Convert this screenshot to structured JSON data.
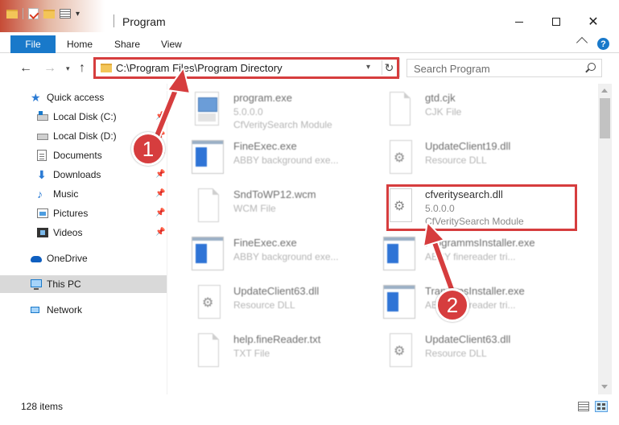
{
  "window": {
    "title": "Program",
    "controls": {
      "minimize": "minimize",
      "maximize": "maximize",
      "close": "✕"
    }
  },
  "ribbon": {
    "tabs": [
      "File",
      "Home",
      "Share",
      "View"
    ],
    "help": "?"
  },
  "address": {
    "path": "C:\\Program Files\\Program Directory",
    "refresh": "↻"
  },
  "search": {
    "placeholder": "Search Program"
  },
  "nav": {
    "items": [
      {
        "label": "Quick access",
        "icon": "star-icon"
      },
      {
        "label": "Local Disk (C:)",
        "icon": "drive-icon",
        "pinned": true
      },
      {
        "label": "Local Disk (D:)",
        "icon": "drive-icon",
        "pinned": true
      },
      {
        "label": "Documents",
        "icon": "documents-icon",
        "pinned": true
      },
      {
        "label": "Downloads",
        "icon": "downloads-icon",
        "pinned": true
      },
      {
        "label": "Music",
        "icon": "music-icon",
        "pinned": true
      },
      {
        "label": "Pictures",
        "icon": "pictures-icon",
        "pinned": true
      },
      {
        "label": "Videos",
        "icon": "videos-icon",
        "pinned": true
      },
      {
        "label": "OneDrive",
        "icon": "onedrive-icon"
      },
      {
        "label": "This PC",
        "icon": "pc-icon",
        "selected": true
      },
      {
        "label": "Network",
        "icon": "network-icon"
      }
    ]
  },
  "files": [
    {
      "name": "program.exe",
      "line2": "5.0.0.0",
      "line3": "CfVeritySearch Module",
      "icon": "setup-icon"
    },
    {
      "name": "gtd.cjk",
      "line2": "CJK File",
      "line3": "",
      "icon": "document-icon"
    },
    {
      "name": "FineExec.exe",
      "line2": "ABBY background exe...",
      "line3": "",
      "icon": "exe-icon"
    },
    {
      "name": "UpdateClient19.dll",
      "line2": "Resource DLL",
      "line3": "",
      "icon": "dll-icon"
    },
    {
      "name": "SndToWP12.wcm",
      "line2": "WCM File",
      "line3": "",
      "icon": "document-icon"
    },
    {
      "name": "cfveritysearch.dll",
      "line2": "5.0.0.0",
      "line3": "CfVeritySearch Module",
      "icon": "dll-icon",
      "highlighted": true
    },
    {
      "name": "FineExec.exe",
      "line2": "ABBY background exe...",
      "line3": "",
      "icon": "exe-icon"
    },
    {
      "name": "ProgrammsInstaller.exe",
      "line2": "ABBY finereader tri...",
      "line3": "",
      "icon": "exe-icon"
    },
    {
      "name": "UpdateClient63.dll",
      "line2": "Resource DLL",
      "line3": "",
      "icon": "dll-icon"
    },
    {
      "name": "TranmmsInstaller.exe",
      "line2": "ABBY finereader tri...",
      "line3": "",
      "icon": "exe-icon"
    },
    {
      "name": "help.fineReader.txt",
      "line2": "TXT File",
      "line3": "",
      "icon": "document-icon"
    },
    {
      "name": "UpdateClient63.dll",
      "line2": "Resource DLL",
      "line3": "",
      "icon": "dll-icon"
    }
  ],
  "status": {
    "items_count": "128 items"
  },
  "annotations": {
    "step1": "1",
    "step2": "2",
    "accent": "#d63d3e"
  }
}
